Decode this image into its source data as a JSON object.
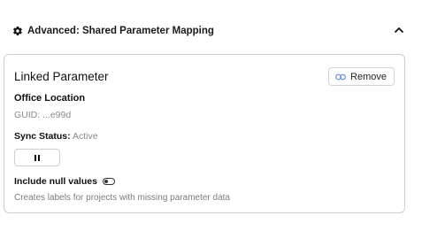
{
  "section": {
    "title": "Advanced: Shared Parameter Mapping",
    "gear_icon": "gear-icon",
    "collapse_icon": "chevron-up-icon"
  },
  "card": {
    "title": "Linked Parameter",
    "remove_label": "Remove",
    "remove_icon": "link-icon",
    "parameter_name": "Office Location",
    "guid": "GUID: ...e99d",
    "sync_label": "Sync Status:",
    "sync_value": "Active",
    "pause_icon": "pause-icon",
    "include_null_label": "Include null values",
    "include_null_enabled": false,
    "help_text": "Creates labels for projects with missing parameter data"
  },
  "colors": {
    "accent_link": "#6b8fd6",
    "border": "#cfcfcf",
    "muted_text": "#8a8a8a"
  }
}
